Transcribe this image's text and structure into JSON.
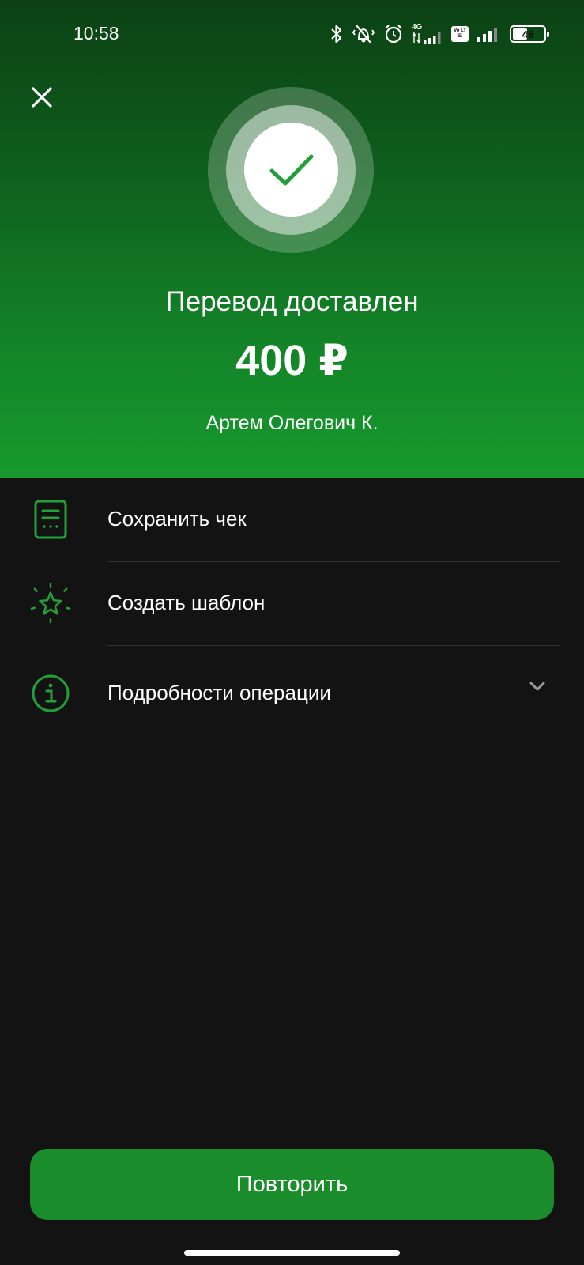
{
  "status_bar": {
    "time": "10:58",
    "network_label": "4G",
    "volte_label": "Vo LTE",
    "battery": "48",
    "battery_level": 0.48
  },
  "hero": {
    "title": "Перевод доставлен",
    "amount": "400 ₽",
    "recipient": "Артем Олегович К."
  },
  "actions": [
    {
      "label": "Сохранить чек",
      "icon": "receipt-icon"
    },
    {
      "label": "Создать шаблон",
      "icon": "star-icon"
    },
    {
      "label": "Подробности операции",
      "icon": "info-icon"
    }
  ],
  "footer": {
    "repeat_label": "Повторить"
  },
  "colors": {
    "accent": "#1a8c2b",
    "icon_green": "#21a038",
    "background": "#131313"
  }
}
